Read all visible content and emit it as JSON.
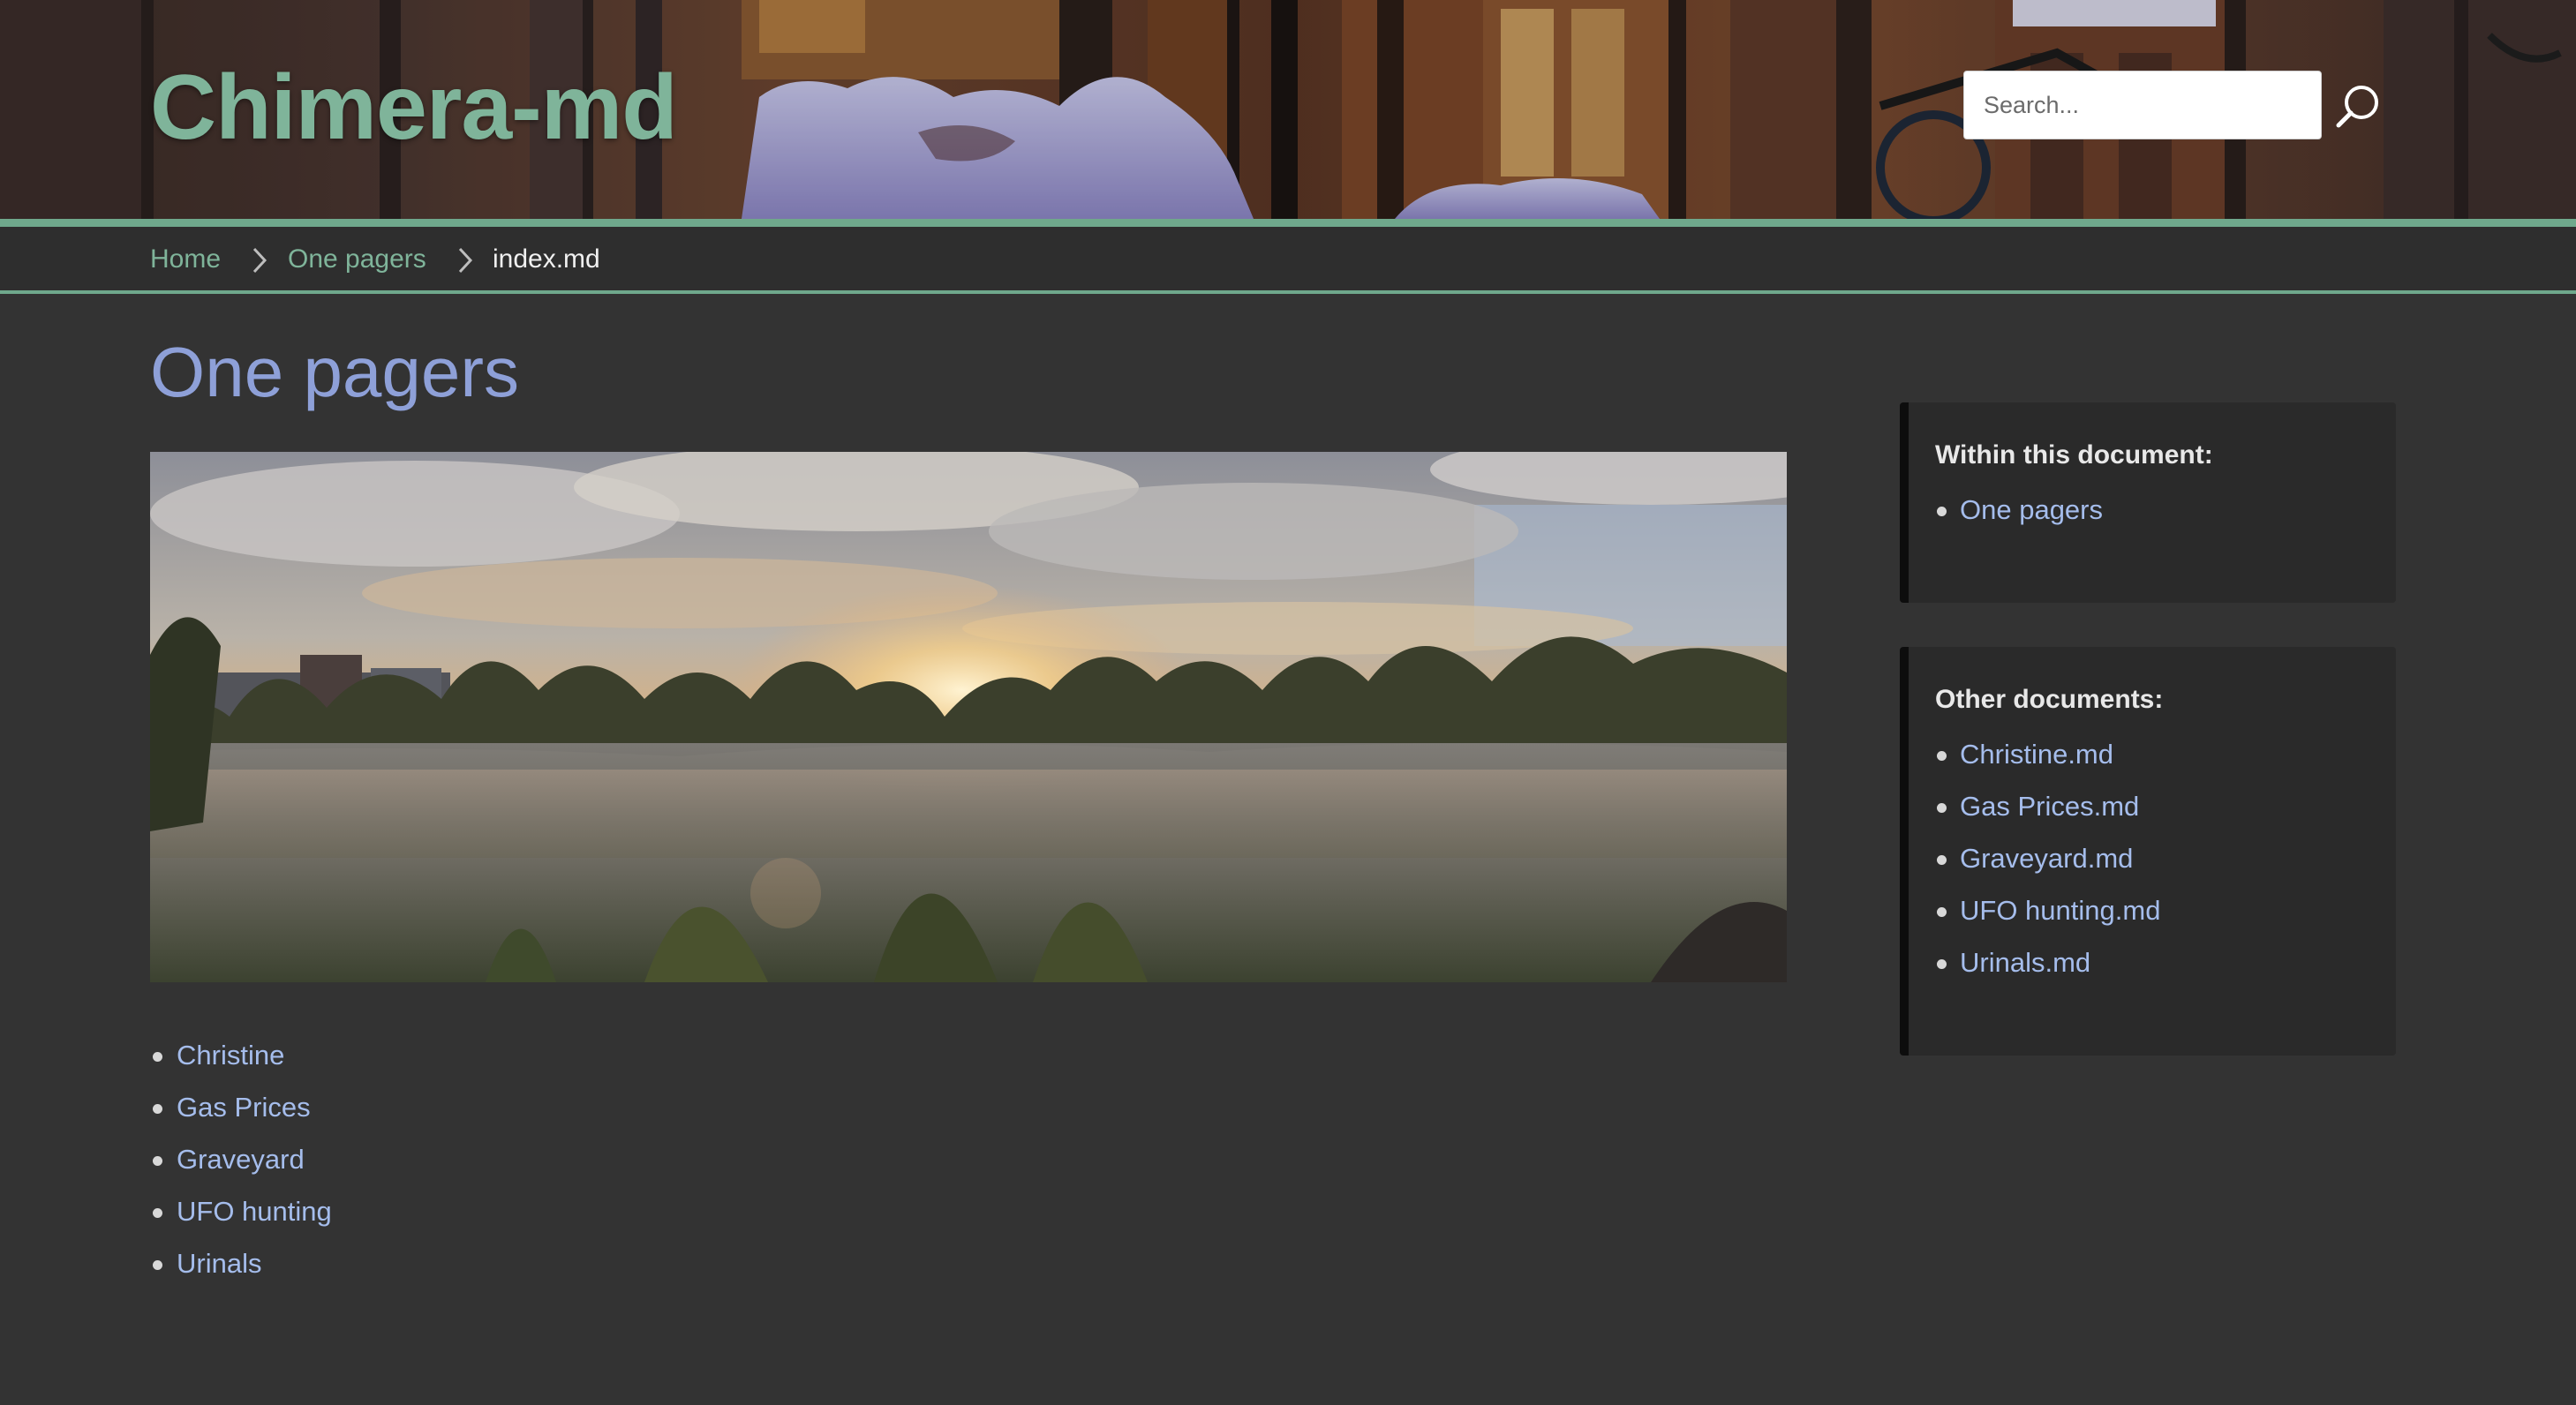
{
  "header": {
    "site_title": "Chimera-md",
    "search_placeholder": "Search...",
    "search_icon": "search-icon"
  },
  "breadcrumb": {
    "items": [
      {
        "label": "Home",
        "link": true
      },
      {
        "label": "One pagers",
        "link": true
      },
      {
        "label": "index.md",
        "link": false
      }
    ],
    "separator_icon": "chevron-right-icon"
  },
  "main": {
    "title": "One pagers",
    "links": [
      "Christine",
      "Gas Prices",
      "Graveyard",
      "UFO hunting",
      "Urinals"
    ]
  },
  "sidebar": {
    "within": {
      "heading": "Within this document:",
      "items": [
        "One pagers"
      ]
    },
    "other": {
      "heading": "Other documents:",
      "items": [
        "Christine.md",
        "Gas Prices.md",
        "Graveyard.md",
        "UFO hunting.md",
        "Urinals.md"
      ]
    }
  },
  "colors": {
    "accent": "#6fa88c",
    "title_green": "#7fb49a",
    "page_title": "#8ea0d8",
    "link": "#a5bdec",
    "background": "#333333",
    "sidebar_bg": "#2a2a2a"
  }
}
